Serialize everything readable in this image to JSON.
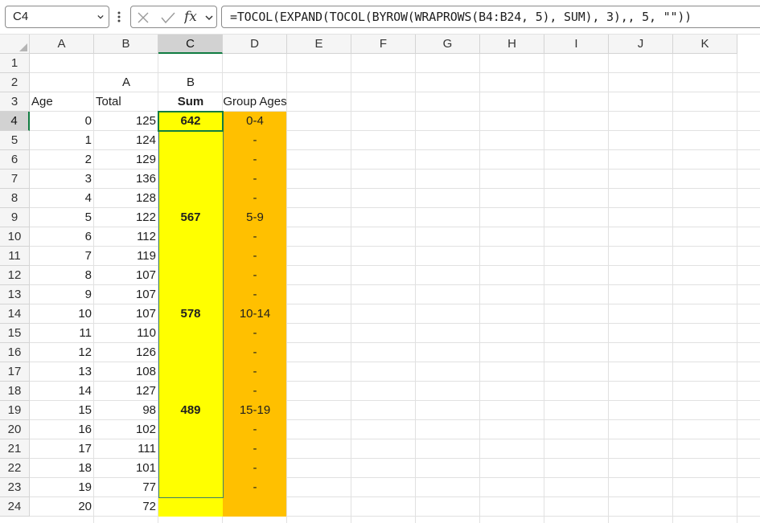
{
  "name_box": {
    "value": "C4"
  },
  "formula": {
    "value": "=TOCOL(EXPAND(TOCOL(BYROW(WRAPROWS(B4:B24, 5), SUM), 3),, 5, \"\"))"
  },
  "icons": {
    "cancel": "x-icon",
    "enter": "check-icon",
    "function": "fx-icon",
    "expand": "chevron-down-icon",
    "more": "vertical-dots-icon"
  },
  "colors": {
    "accent": "#107c41",
    "sum_fill": "#ffff00",
    "group_fill": "#ffc000"
  },
  "columns": [
    "A",
    "B",
    "C",
    "D",
    "E",
    "F",
    "G",
    "H",
    "I",
    "J",
    "K"
  ],
  "selected_column": "C",
  "selected_row": "4",
  "rows": [
    "1",
    "2",
    "3",
    "4",
    "5",
    "6",
    "7",
    "8",
    "9",
    "10",
    "11",
    "12",
    "13",
    "14",
    "15",
    "16",
    "17",
    "18",
    "19",
    "20",
    "21",
    "22",
    "23",
    "24"
  ],
  "sheet": {
    "r2": {
      "b": "A",
      "c": "B"
    },
    "r3": {
      "a": "Age",
      "b": "Total",
      "c": "Sum",
      "d": "Group Ages"
    },
    "ages": [
      "0",
      "1",
      "2",
      "3",
      "4",
      "5",
      "6",
      "7",
      "8",
      "9",
      "10",
      "11",
      "12",
      "13",
      "14",
      "15",
      "16",
      "17",
      "18",
      "19",
      "20"
    ],
    "totals": [
      "125",
      "124",
      "129",
      "136",
      "128",
      "122",
      "112",
      "119",
      "107",
      "107",
      "107",
      "110",
      "126",
      "108",
      "127",
      "98",
      "102",
      "111",
      "101",
      "77",
      "72"
    ],
    "sums": [
      "642",
      "",
      "",
      "",
      "",
      "567",
      "",
      "",
      "",
      "",
      "578",
      "",
      "",
      "",
      "",
      "489",
      "",
      "",
      "",
      "",
      ""
    ],
    "groups": [
      "0-4",
      "-",
      "-",
      "-",
      "-",
      "5-9",
      "-",
      "-",
      "-",
      "-",
      "10-14",
      "-",
      "-",
      "-",
      "-",
      "15-19",
      "-",
      "-",
      "-",
      "-",
      ""
    ]
  }
}
